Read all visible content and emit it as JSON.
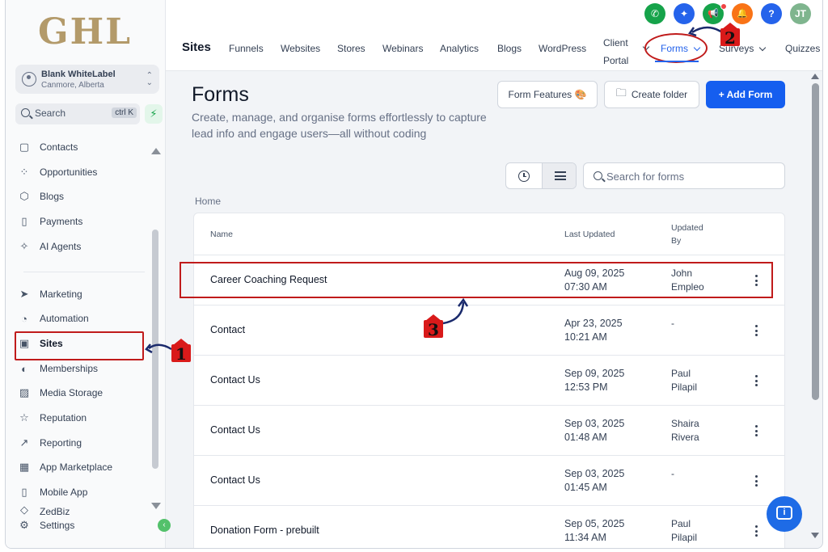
{
  "brand": {
    "logo_text": "GHL"
  },
  "account": {
    "name": "Blank WhiteLabel",
    "location": "Canmore, Alberta"
  },
  "sidebar_search": {
    "label": "Search",
    "shortcut": "ctrl K"
  },
  "sidebar": {
    "items": [
      {
        "label": "Contacts",
        "icon": "contacts-icon",
        "glyph": "▢"
      },
      {
        "label": "Opportunities",
        "icon": "opportunities-icon",
        "glyph": "⁘"
      },
      {
        "label": "Blogs",
        "icon": "blogs-icon",
        "glyph": "⬡"
      },
      {
        "label": "Payments",
        "icon": "payments-icon",
        "glyph": "▯"
      },
      {
        "label": "AI Agents",
        "icon": "ai-agents-icon",
        "glyph": "✧"
      },
      {
        "label": "Marketing",
        "icon": "marketing-icon",
        "glyph": "➤"
      },
      {
        "label": "Automation",
        "icon": "automation-icon",
        "glyph": "◔"
      },
      {
        "label": "Sites",
        "icon": "sites-icon",
        "glyph": "▣"
      },
      {
        "label": "Memberships",
        "icon": "memberships-icon",
        "glyph": "◐"
      },
      {
        "label": "Media Storage",
        "icon": "media-storage-icon",
        "glyph": "▨"
      },
      {
        "label": "Reputation",
        "icon": "reputation-icon",
        "glyph": "☆"
      },
      {
        "label": "Reporting",
        "icon": "reporting-icon",
        "glyph": "↗"
      },
      {
        "label": "App Marketplace",
        "icon": "app-marketplace-icon",
        "glyph": "▦"
      },
      {
        "label": "Mobile App",
        "icon": "mobile-app-icon",
        "glyph": "▯"
      },
      {
        "label": "ZedBiz",
        "icon": "zedbiz-icon",
        "glyph": "◇"
      }
    ],
    "settings_label": "Settings"
  },
  "header_icons": [
    {
      "name": "phone-icon",
      "glyph": "✆",
      "color": "#16a34a"
    },
    {
      "name": "magic-icon",
      "glyph": "✦",
      "color": "#2563eb"
    },
    {
      "name": "megaphone-icon",
      "glyph": "📢",
      "color": "#16a34a"
    },
    {
      "name": "bell-icon",
      "glyph": "🔔",
      "color": "#f97316"
    },
    {
      "name": "help-icon",
      "glyph": "?",
      "color": "#2563eb"
    },
    {
      "name": "user-avatar",
      "glyph": "JT",
      "color": "#7fb58e"
    }
  ],
  "tabs": {
    "section": "Sites",
    "items": [
      "Funnels",
      "Websites",
      "Stores",
      "Webinars",
      "Analytics",
      "Blogs",
      "WordPress"
    ],
    "client_portal": [
      "Client",
      "Portal"
    ],
    "forms": "Forms",
    "surveys": "Surveys",
    "quizzes": "Quizzes"
  },
  "page": {
    "title": "Forms",
    "subtitle": "Create, manage, and organise forms effortlessly to capture lead info and engage users—all without coding",
    "buttons": {
      "form_features": "Form Features",
      "form_features_emoji": "🎨",
      "create_folder": "Create folder",
      "add_form": "+ Add Form"
    },
    "search_placeholder": "Search for forms",
    "breadcrumb": "Home"
  },
  "table": {
    "headers": {
      "name": "Name",
      "last_updated": "Last Updated",
      "updated_by": [
        "Updated",
        "By"
      ]
    },
    "rows": [
      {
        "name": "Career Coaching Request",
        "date": "Aug 09, 2025",
        "time": "07:30 AM",
        "by1": "John",
        "by2": "Empleo"
      },
      {
        "name": "Contact",
        "date": "Apr 23, 2025",
        "time": "10:21 AM",
        "by1": "-",
        "by2": ""
      },
      {
        "name": "Contact Us",
        "date": "Sep 09, 2025",
        "time": "12:53 PM",
        "by1": "Paul",
        "by2": "Pilapil"
      },
      {
        "name": "Contact Us",
        "date": "Sep 03, 2025",
        "time": "01:48 AM",
        "by1": "Shaira",
        "by2": "Rivera"
      },
      {
        "name": "Contact Us",
        "date": "Sep 03, 2025",
        "time": "01:45 AM",
        "by1": "-",
        "by2": ""
      },
      {
        "name": "Donation Form - prebuilt",
        "date": "Sep 05, 2025",
        "time": "11:34 AM",
        "by1": "Paul",
        "by2": "Pilapil"
      }
    ]
  },
  "annotations": {
    "step1": "1",
    "step2": "2",
    "step3": "3"
  },
  "colors": {
    "primary": "#155eef",
    "annotation_red": "#c01b1b",
    "logo": "#b39a6a"
  }
}
